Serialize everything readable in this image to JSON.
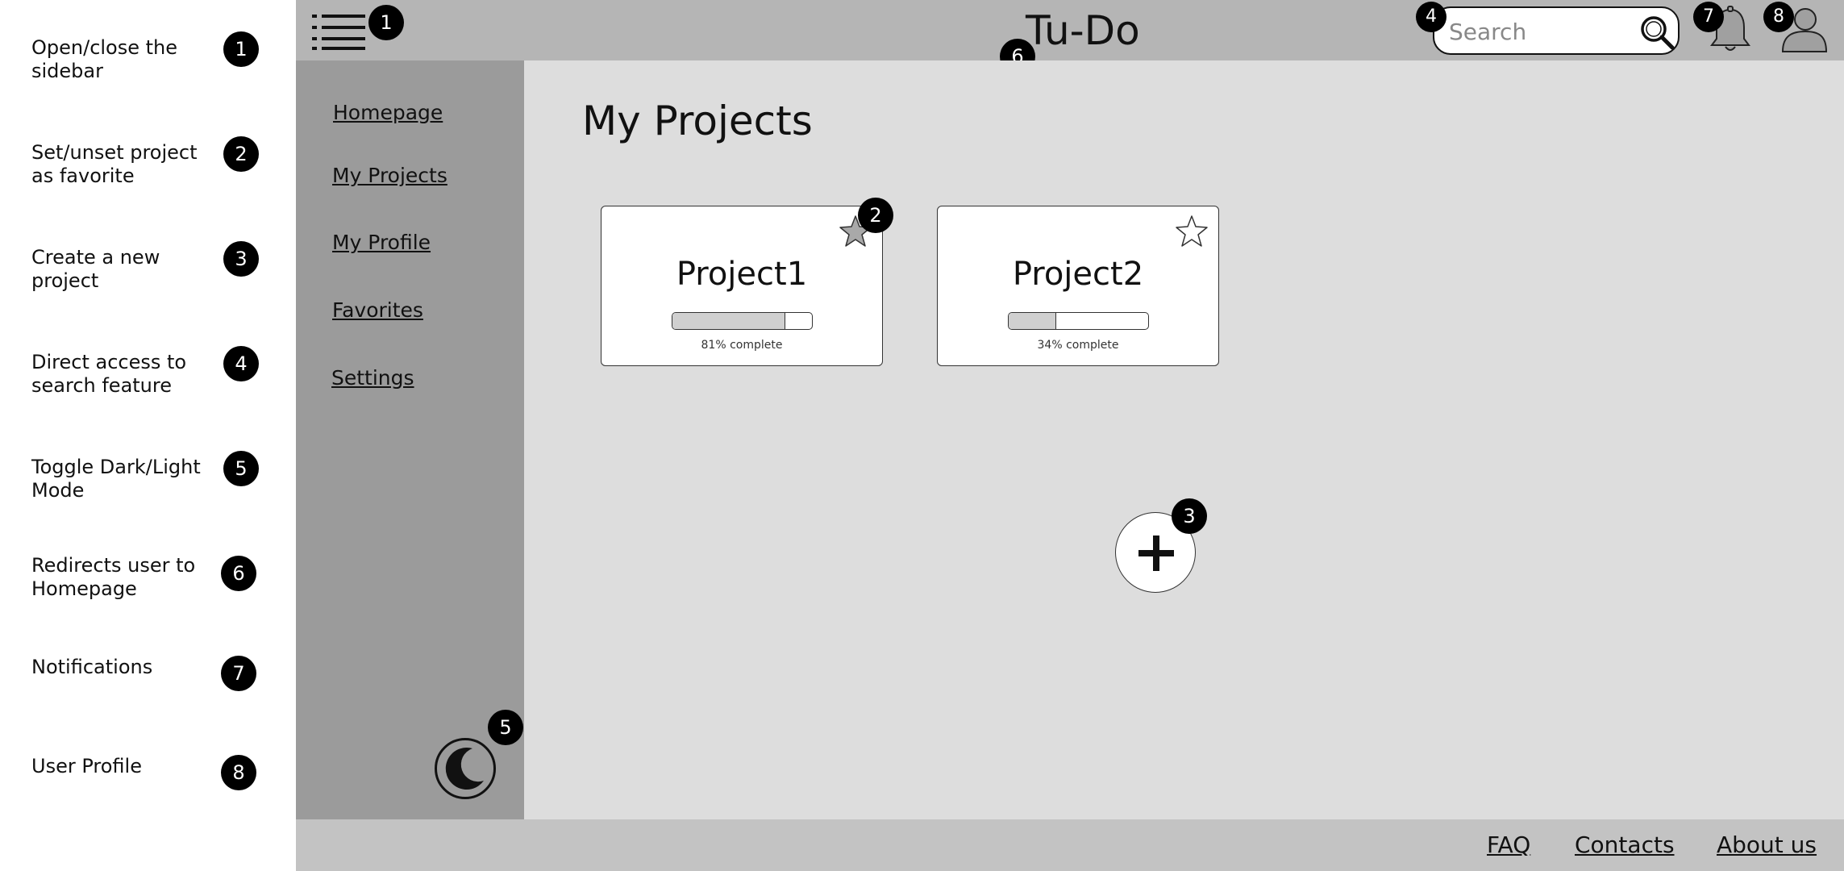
{
  "legend": {
    "items": [
      {
        "text": "Open/close the sidebar",
        "num": "1"
      },
      {
        "text": "Set/unset project as favorite",
        "num": "2"
      },
      {
        "text": "Create a new project",
        "num": "3"
      },
      {
        "text": "Direct access to search feature",
        "num": "4"
      },
      {
        "text": "Toggle Dark/Light Mode",
        "num": "5"
      },
      {
        "text": "Redirects user to Homepage",
        "num": "6"
      },
      {
        "text": "Notifications",
        "num": "7"
      },
      {
        "text": "User Profile",
        "num": "8"
      }
    ]
  },
  "header": {
    "title": "Tu-Do",
    "search_placeholder": "Search"
  },
  "sidebar": {
    "items": [
      {
        "label": "Homepage"
      },
      {
        "label": "My Projects"
      },
      {
        "label": "My Profile"
      },
      {
        "label": "Favorites"
      },
      {
        "label": "Settings"
      }
    ]
  },
  "main": {
    "title": "My Projects",
    "projects": [
      {
        "name": "Project1",
        "caption": "81% complete",
        "progress": 0.81,
        "favorite": true
      },
      {
        "name": "Project2",
        "caption": "34% complete",
        "progress": 0.34,
        "favorite": false
      }
    ]
  },
  "footer": {
    "links": [
      {
        "label": "FAQ"
      },
      {
        "label": "Contacts"
      },
      {
        "label": "About us"
      }
    ]
  },
  "annotations": {
    "b1": "1",
    "b2": "2",
    "b3": "3",
    "b4": "4",
    "b5": "5",
    "b6": "6",
    "b7": "7",
    "b8": "8"
  },
  "colors": {
    "header_bg": "#b5b5b5",
    "sidebar_bg": "#9b9b9b",
    "main_bg": "#dddddd",
    "footer_bg": "#c3c3c3",
    "favorite_fill": "#a9a9a9",
    "badge": "#000000"
  },
  "icons": {
    "menu": "hamburger-menu-icon",
    "search": "magnifier-icon",
    "notifications": "bell-icon",
    "profile": "user-icon",
    "theme": "crescent-moon-icon",
    "favorite": "star-icon",
    "add": "plus-icon"
  }
}
